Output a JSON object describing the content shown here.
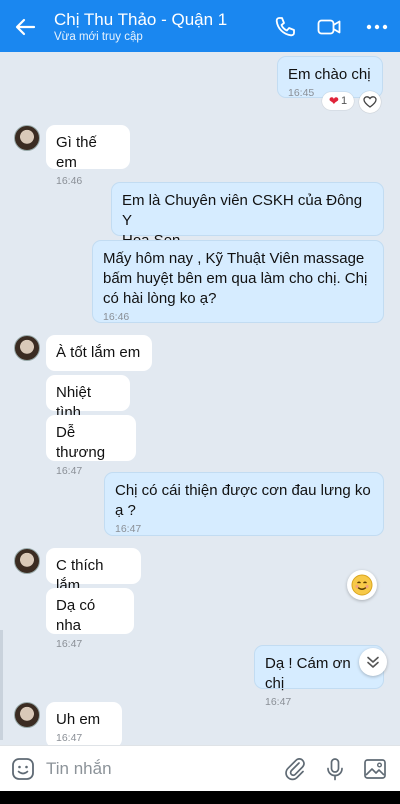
{
  "header": {
    "title": "Chị Thu Thảo - Quận 1",
    "subtitle": "Vừa mới truy cập",
    "icons": [
      "back-arrow-icon",
      "phone-icon",
      "video-call-icon",
      "more-icon"
    ]
  },
  "messages": [
    {
      "dir": "out",
      "text": "Em chào chị",
      "time": "16:45"
    },
    {
      "dir": "in",
      "text": "Gì thế em",
      "time": "16:46"
    },
    {
      "dir": "out",
      "text": "Em là Chuyên viên CSKH của Đông Y\nHoa Sen",
      "time": ""
    },
    {
      "dir": "out",
      "text": "Mấy hôm nay , Kỹ Thuật Viên massage\nbấm huyệt bên em qua làm cho chị. Chị\ncó hài lòng ko ạ?",
      "time": "16:46"
    },
    {
      "dir": "in",
      "text": "À tốt lắm em",
      "time": ""
    },
    {
      "dir": "in",
      "text": "Nhiệt tình",
      "time": ""
    },
    {
      "dir": "in",
      "text": "Dễ thương",
      "time": "16:47"
    },
    {
      "dir": "out",
      "text": "Chị có cái thiện được cơn đau lưng ko\nạ ?",
      "time": "16:47"
    },
    {
      "dir": "in",
      "text": "C thích lắm",
      "time": ""
    },
    {
      "dir": "in",
      "text": "Dạ có nha",
      "time": "16:47"
    },
    {
      "dir": "out",
      "text": "Dạ ! Cám ơn chị",
      "time": "16:47"
    },
    {
      "dir": "in",
      "text": "Uh em",
      "time": "16:47"
    }
  ],
  "reaction": {
    "count": "1",
    "emoji": "heart"
  },
  "input": {
    "placeholder": "Tin nhắn"
  },
  "colors": {
    "header": "#1a87f0",
    "chat_bg": "#e2e9f1",
    "outgoing": "#d6ecff",
    "incoming": "#ffffff"
  }
}
